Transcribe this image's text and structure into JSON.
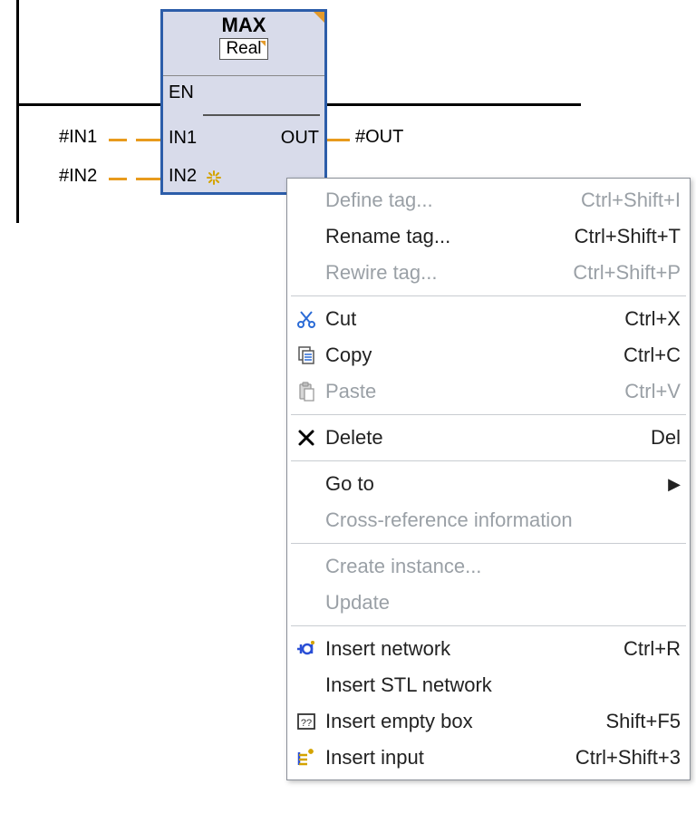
{
  "block": {
    "title": "MAX",
    "type": "Real",
    "pins": {
      "en": "EN",
      "in1": "IN1",
      "in2": "IN2",
      "out": "OUT"
    }
  },
  "tags": {
    "in1": "#IN1",
    "in2": "#IN2",
    "out": "#OUT"
  },
  "menu": {
    "defineTag": {
      "label": "Define tag...",
      "shortcut": "Ctrl+Shift+I"
    },
    "renameTag": {
      "label": "Rename tag...",
      "shortcut": "Ctrl+Shift+T"
    },
    "rewireTag": {
      "label": "Rewire tag...",
      "shortcut": "Ctrl+Shift+P"
    },
    "cut": {
      "label": "Cut",
      "shortcut": "Ctrl+X"
    },
    "copy": {
      "label": "Copy",
      "shortcut": "Ctrl+C"
    },
    "paste": {
      "label": "Paste",
      "shortcut": "Ctrl+V"
    },
    "delete": {
      "label": "Delete",
      "shortcut": "Del"
    },
    "goto": {
      "label": "Go to"
    },
    "crossRef": {
      "label": "Cross-reference information"
    },
    "createInstance": {
      "label": "Create instance..."
    },
    "update": {
      "label": "Update"
    },
    "insertNetwork": {
      "label": "Insert network",
      "shortcut": "Ctrl+R"
    },
    "insertSTL": {
      "label": "Insert STL network"
    },
    "insertEmptyBox": {
      "label": "Insert empty box",
      "shortcut": "Shift+F5"
    },
    "insertInput": {
      "label": "Insert input",
      "shortcut": "Ctrl+Shift+3"
    }
  }
}
